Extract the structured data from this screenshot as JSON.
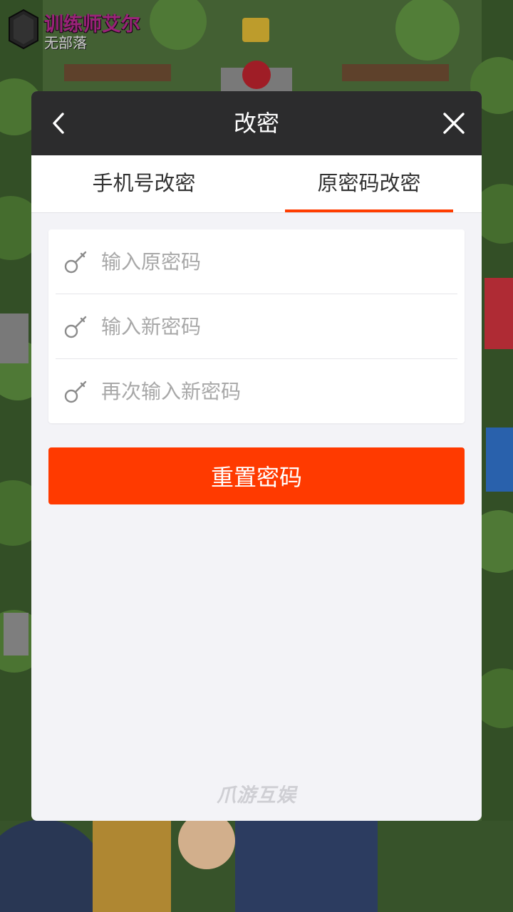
{
  "game": {
    "player_name": "训练师艾尔",
    "clan": "无部落"
  },
  "dialog": {
    "title": "改密",
    "back_icon": "chevron-left-icon",
    "close_icon": "close-icon"
  },
  "tabs": [
    {
      "label": "手机号改密",
      "active": false
    },
    {
      "label": "原密码改密",
      "active": true
    }
  ],
  "form": {
    "fields": [
      {
        "placeholder": "输入原密码",
        "value": "",
        "icon": "key-icon"
      },
      {
        "placeholder": "输入新密码",
        "value": "",
        "icon": "key-icon"
      },
      {
        "placeholder": "再次输入新密码",
        "value": "",
        "icon": "key-icon"
      }
    ],
    "submit_label": "重置密码"
  },
  "footer": {
    "brand": "爪游互娱"
  },
  "colors": {
    "accent": "#ff3a00",
    "header_bg": "#141414",
    "panel_bg": "#f3f3f7"
  }
}
